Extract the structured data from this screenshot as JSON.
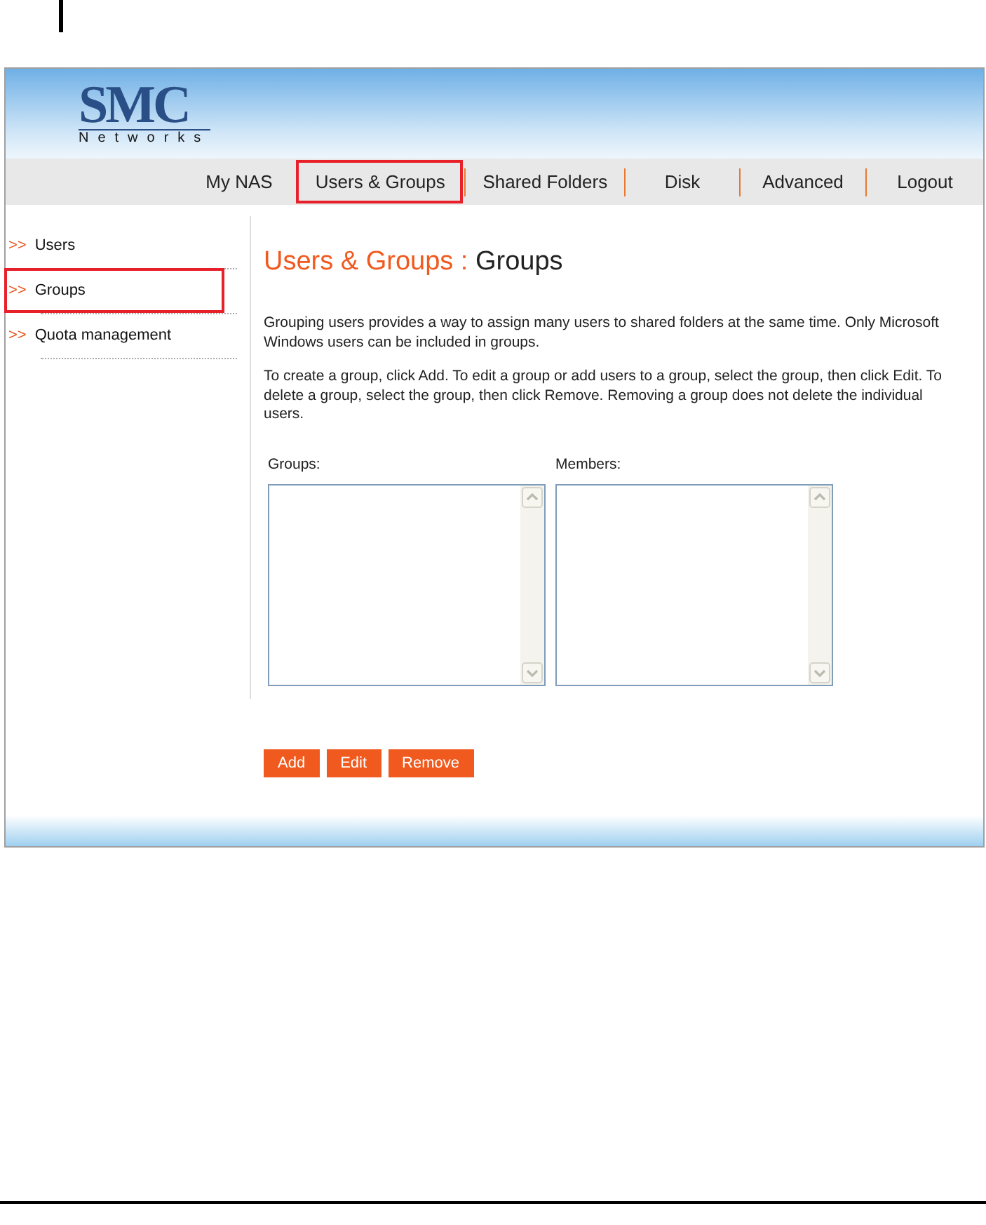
{
  "logo": {
    "brand": "SMC",
    "subtitle": "Networks"
  },
  "nav": [
    {
      "label": "My NAS",
      "selected": false
    },
    {
      "label": "Users & Groups",
      "selected": true
    },
    {
      "label": "Shared Folders",
      "selected": false
    },
    {
      "label": "Disk",
      "selected": false
    },
    {
      "label": "Advanced",
      "selected": false
    },
    {
      "label": "Logout",
      "selected": false
    }
  ],
  "sidebar": {
    "items": [
      {
        "marker": ">>",
        "label": "Users",
        "selected": false
      },
      {
        "marker": ">>",
        "label": "Groups",
        "selected": true
      },
      {
        "marker": ">>",
        "label": "Quota management",
        "selected": false
      }
    ]
  },
  "page_title": {
    "section": "Users & Groups :",
    "page": "Groups"
  },
  "paragraphs": [
    "Grouping users provides a way to assign many users to shared folders at the same time. Only Microsoft Windows users can be included in groups.",
    "To create a group, click Add. To edit a group or add users to a group, select the group, then click Edit. To delete a group, select the group, then click Remove. Removing a group does not delete the individual users."
  ],
  "lists": [
    {
      "label": "Groups:"
    },
    {
      "label": "Members:"
    }
  ],
  "buttons": [
    "Add",
    "Edit",
    "Remove"
  ]
}
